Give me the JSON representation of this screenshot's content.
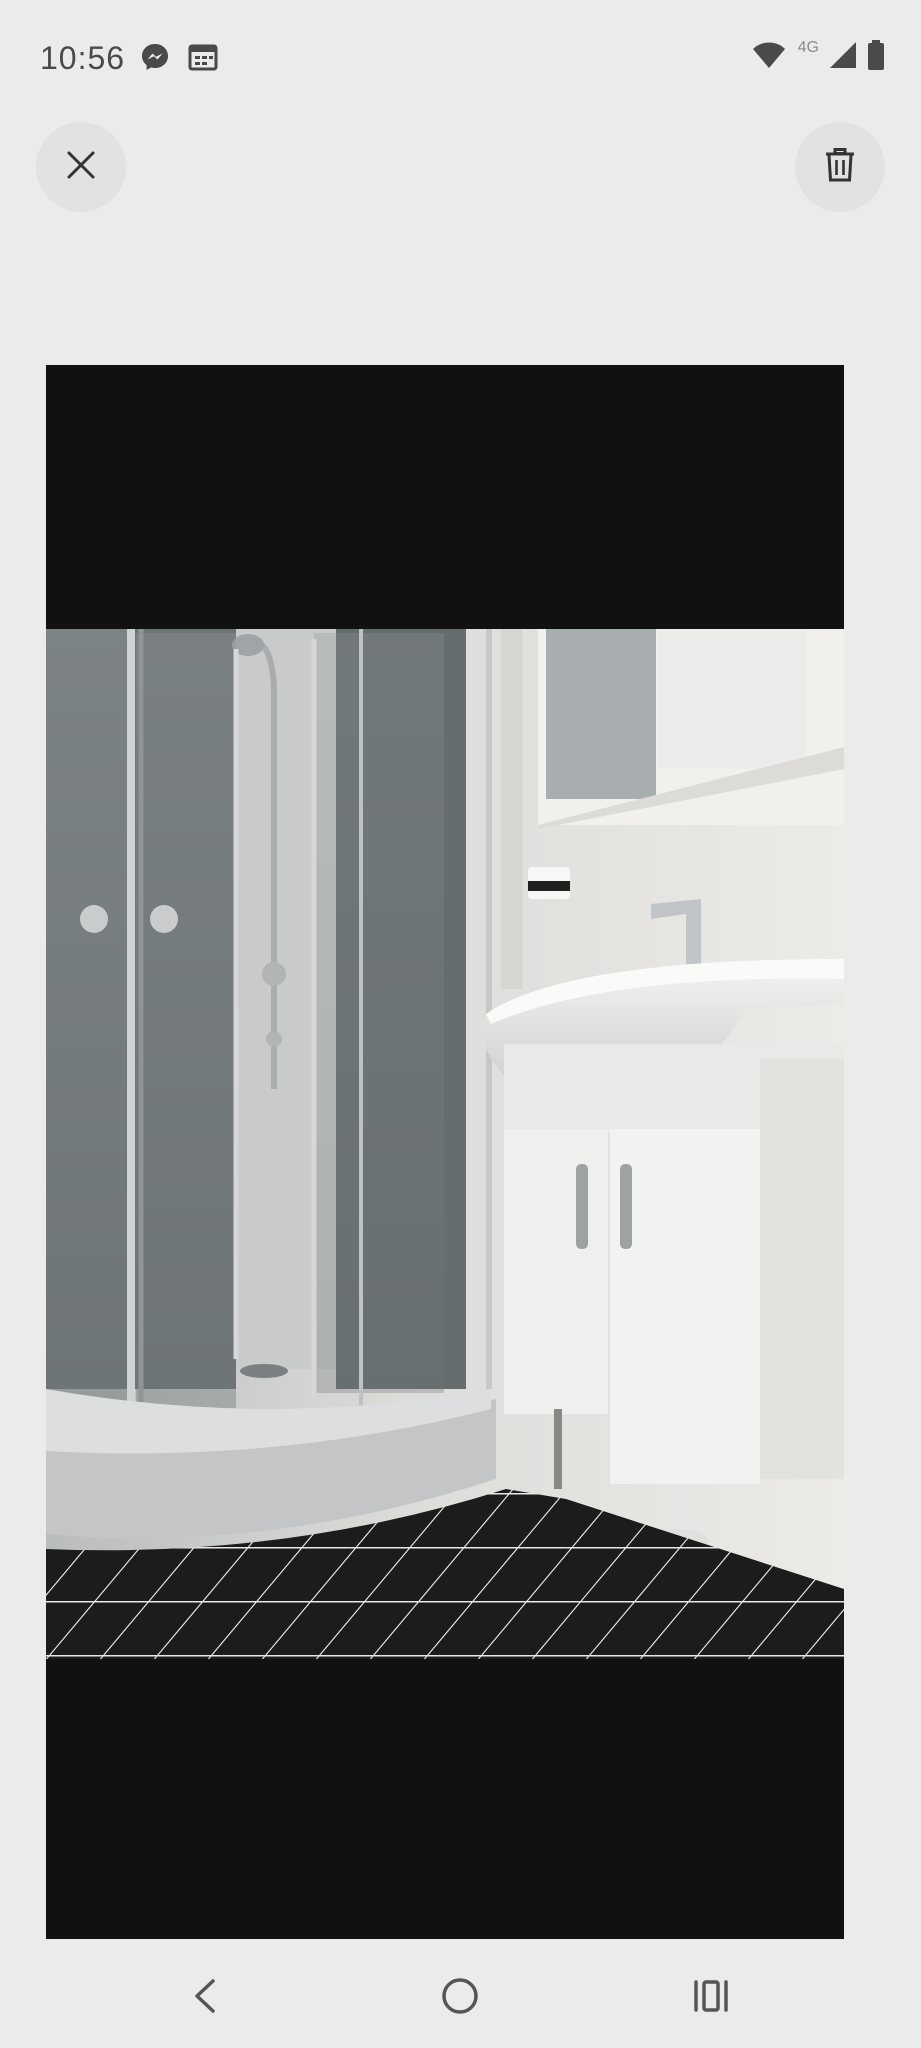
{
  "status_bar": {
    "time": "10:56",
    "network_label": "4G",
    "icons": [
      "messenger-icon",
      "calendar-icon",
      "wifi-icon",
      "cellular-signal-icon",
      "battery-icon"
    ]
  },
  "toolbar": {
    "close_icon": "close-icon",
    "delete_icon": "trash-icon"
  },
  "photo": {
    "subject": "bathroom-photo"
  },
  "nav_bar": {
    "icons": [
      "back-icon",
      "home-icon",
      "recents-icon"
    ]
  },
  "colors": {
    "background": "#ebebeb",
    "button_bg": "#e2e2e2",
    "letterbox": "#111111",
    "icon": "#333333"
  }
}
